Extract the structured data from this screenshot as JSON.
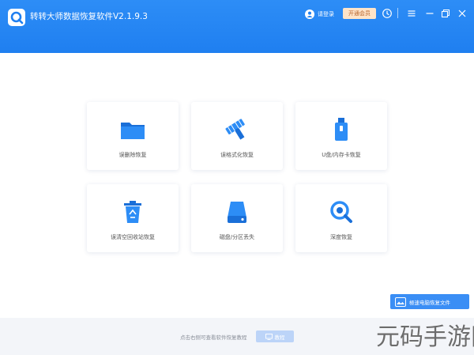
{
  "window": {
    "title": "转转大师数据恢复软件V2.1.9.3",
    "login_label": "请登录",
    "vip_label": "开通会员"
  },
  "cards": [
    {
      "icon": "folder-icon",
      "label": "误删除恢复"
    },
    {
      "icon": "format-icon",
      "label": "误格式化恢复"
    },
    {
      "icon": "usb-drive-icon",
      "label": "U盘/内存卡恢复"
    },
    {
      "icon": "recycle-bin-icon",
      "label": "误清空回收站恢复"
    },
    {
      "icon": "disk-icon",
      "label": "磁盘/分区丢失"
    },
    {
      "icon": "deep-scan-icon",
      "label": "深度恢复"
    }
  ],
  "side_button": {
    "label": "極速电脑恢复文件"
  },
  "footer": {
    "hint": "点击右侧可查看软件恢复教程",
    "tutorial_label": "教程"
  },
  "watermark": "元码手游网",
  "colors": {
    "header_blue": "#1f7ff0",
    "icon_blue": "#2d8df6",
    "vip_bg": "#ffe4c8"
  }
}
